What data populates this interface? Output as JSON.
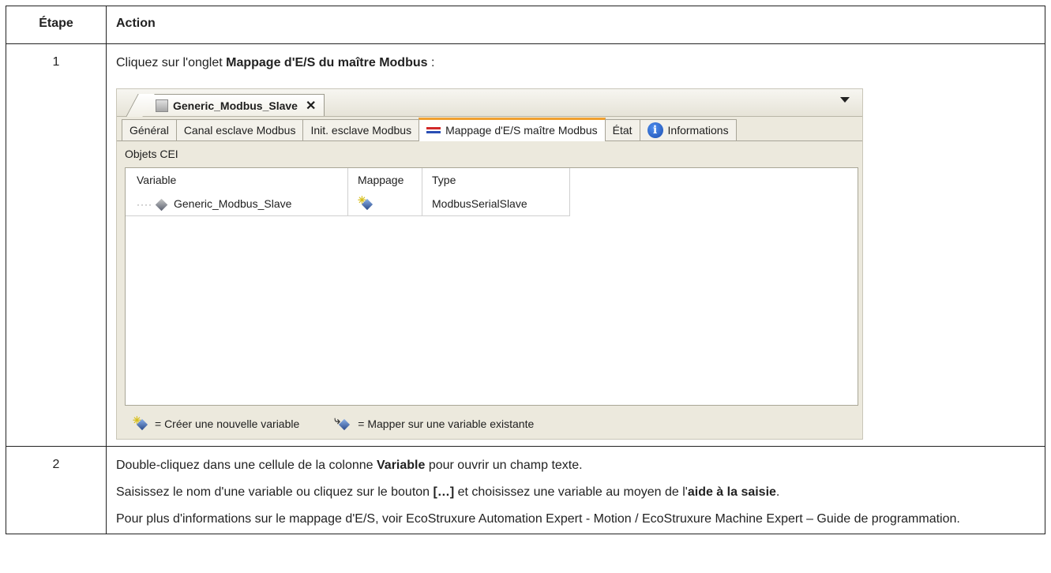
{
  "table": {
    "header_step": "Étape",
    "header_action": "Action"
  },
  "rows": [
    {
      "step": "1",
      "intro_text": "Cliquez sur l'onglet ",
      "intro_bold": "Mappage d'E/S du maître Modbus",
      "intro_suffix": " :"
    },
    {
      "step": "2",
      "p1_text": "Double-cliquez dans une cellule de la colonne ",
      "p1_bold": "Variable",
      "p1_suffix": " pour ouvrir un champ texte.",
      "p2_text": "Saisissez le nom d'une variable ou cliquez sur le bouton ",
      "p2_bold": "[…]",
      "p2_mid": " et choisissez une variable au moyen de l'",
      "p2_bold2": "aide à la saisie",
      "p2_suffix": ".",
      "p3_text": "Pour plus d'informations sur le mappage d'E/S, voir EcoStruxure Automation Expert - Motion / EcoStruxure Machine Expert – Guide de programmation."
    }
  ],
  "screenshot": {
    "doc_tab_title": "Generic_Modbus_Slave",
    "doc_tab_close": "✕",
    "tabs": [
      {
        "label": "Général",
        "icon": null,
        "active": false
      },
      {
        "label": "Canal esclave Modbus",
        "icon": null,
        "active": false
      },
      {
        "label": "Init. esclave Modbus",
        "icon": null,
        "active": false
      },
      {
        "label": "Mappage d'E/S maître Modbus",
        "icon": "arrows-icon",
        "active": true
      },
      {
        "label": "État",
        "icon": null,
        "active": false
      },
      {
        "label": "Informations",
        "icon": "info-icon",
        "active": false
      }
    ],
    "group_label": "Objets CEI",
    "columns": [
      "Variable",
      "Mappage",
      "Type"
    ],
    "row": {
      "variable": "Generic_Modbus_Slave",
      "type": "ModbusSerialSlave"
    },
    "legend": {
      "new_var": "= Créer une nouvelle variable",
      "existing_var": "= Mapper sur une variable existante"
    },
    "info_glyph": "i"
  }
}
